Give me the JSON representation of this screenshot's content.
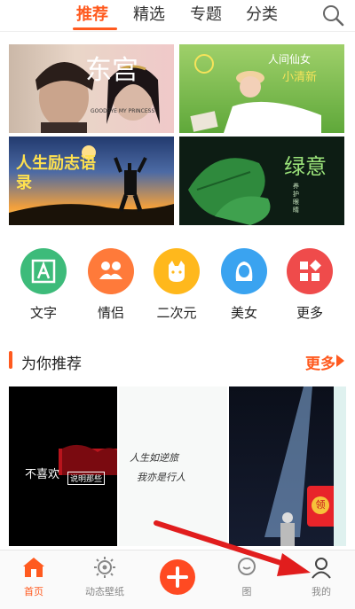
{
  "tabs": [
    "推荐",
    "精选",
    "专题",
    "分类"
  ],
  "banners": {
    "b1_title": "东宫",
    "b1_sub": "GOODBYE MY PRINCESS",
    "b2_title": "人间仙女",
    "b2_sub": "小清新",
    "b3_title": "人生励志语录",
    "b4_title": "绿意",
    "b4_side": "养护眼睛"
  },
  "categories": [
    {
      "label": "文字",
      "icon": "text-icon",
      "color": "#3dbb7a"
    },
    {
      "label": "情侣",
      "icon": "couple-icon",
      "color": "#ff7a3a"
    },
    {
      "label": "二次元",
      "icon": "cat-icon",
      "color": "#ffb81c"
    },
    {
      "label": "美女",
      "icon": "woman-icon",
      "color": "#3aa3f0"
    },
    {
      "label": "更多",
      "icon": "grid-icon",
      "color": "#ef4b4b"
    }
  ],
  "section": {
    "title": "为你推荐",
    "more": "更多"
  },
  "thumbs": {
    "t1_text": "不喜欢",
    "t1_small": "说明那些",
    "t2_line1": "人生如逆旅",
    "t2_line2": "我亦是行人"
  },
  "red_tag": "领",
  "nav": [
    {
      "label": "首页",
      "icon": "home-icon"
    },
    {
      "label": "动态壁纸",
      "icon": "live-wallpaper-icon"
    },
    {
      "label": "",
      "icon": "add-icon"
    },
    {
      "label": "图",
      "icon": "image-icon"
    },
    {
      "label": "我的",
      "icon": "user-icon"
    }
  ],
  "colors": {
    "accent": "#ff5a1f"
  }
}
